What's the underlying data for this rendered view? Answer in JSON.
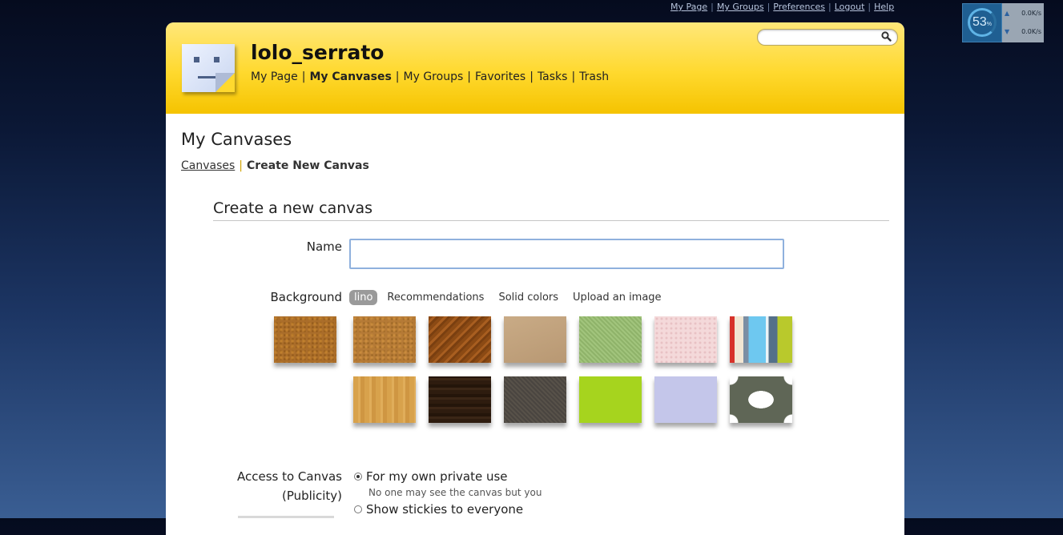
{
  "top_links": [
    {
      "label": "My Page"
    },
    {
      "label": "My Groups"
    },
    {
      "label": "Preferences"
    },
    {
      "label": "Logout"
    },
    {
      "label": "Help"
    }
  ],
  "net_widget": {
    "percent": "53",
    "percent_unit": "%",
    "up_rate": "0.0K/s",
    "down_rate": "0.0K/s"
  },
  "header": {
    "username": "lolo_serrato",
    "nav": [
      {
        "label": "My Page",
        "active": false
      },
      {
        "label": "My Canvases",
        "active": true
      },
      {
        "label": "My Groups",
        "active": false
      },
      {
        "label": "Favorites",
        "active": false
      },
      {
        "label": "Tasks",
        "active": false
      },
      {
        "label": "Trash",
        "active": false
      }
    ],
    "separator": "|",
    "search_value": ""
  },
  "page": {
    "title": "My Canvases",
    "breadcrumb_link": "Canvases",
    "breadcrumb_sep": "|",
    "breadcrumb_current": "Create New Canvas"
  },
  "form": {
    "section_title": "Create a new canvas",
    "name_label": "Name",
    "name_value": "",
    "background_label": "Background",
    "background_tabs": [
      {
        "label": "lino",
        "active": true
      },
      {
        "label": "Recommendations",
        "active": false
      },
      {
        "label": "Solid colors",
        "active": false
      },
      {
        "label": "Upload an image",
        "active": false
      }
    ],
    "access_label": "Access to Canvas",
    "access_sublabel": "(Publicity)",
    "access_options": [
      {
        "label": "For my own private use",
        "checked": true
      },
      {
        "label": "Show stickies to everyone",
        "checked": false
      }
    ],
    "private_note": "No one may see the canvas but you"
  },
  "colors": {
    "header_yellow": "#ffd92e",
    "input_border": "#8fb1dd"
  }
}
